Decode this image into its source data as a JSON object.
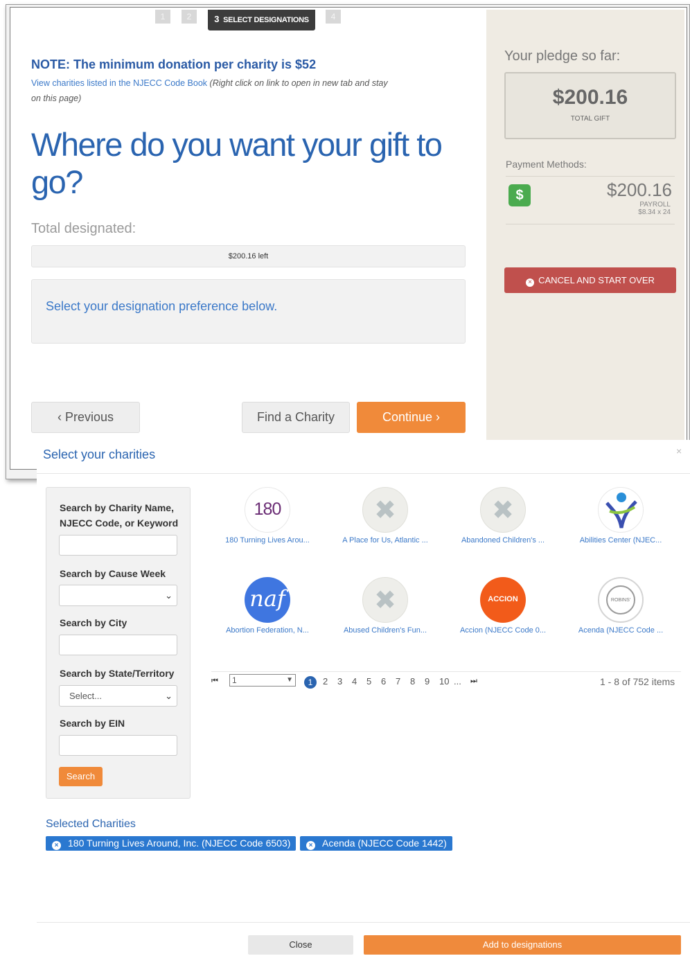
{
  "steps": {
    "s1": "1",
    "s2": "2",
    "active_num": "3",
    "active_label": "SELECT DESIGNATIONS",
    "s4": "4"
  },
  "note": {
    "title": "NOTE: The minimum donation per charity is $52",
    "link_text": "View charities listed in the NJECC Code Book",
    "hint": "(Right click on link to open in new tab and stay on this page)"
  },
  "headline": "Where do you want your gift to go?",
  "total_designated_label": "Total designated:",
  "progress_text": "$200.16 left",
  "preference_text": "Select your designation preference below.",
  "nav": {
    "previous": "Previous",
    "find": "Find a Charity",
    "continue": "Continue"
  },
  "pledge": {
    "title": "Your pledge so far:",
    "amount": "$200.16",
    "sub": "TOTAL GIFT",
    "payment_label": "Payment Methods:",
    "payment_icon": "$",
    "payment_amount": "$200.16",
    "payment_type": "PAYROLL",
    "payment_detail": "$8.34 x 24",
    "cancel": "CANCEL AND START OVER"
  },
  "modal": {
    "title": "Select your charities",
    "close_glyph": "×",
    "search": {
      "name_label": "Search by Charity Name, NJECC Code, or Keyword",
      "cause_label": "Search by Cause Week",
      "city_label": "Search by City",
      "state_label": "Search by State/Territory",
      "state_value": "Select...",
      "ein_label": "Search by EIN",
      "button": "Search"
    },
    "charities": [
      {
        "name": "180 Turning Lives Arou...",
        "logo_text": "180",
        "logo": "180-logo"
      },
      {
        "name": "A Place for Us, Atlantic ...",
        "logo_text": "",
        "logo": "ribbon-icon"
      },
      {
        "name": "Abandoned Children's ...",
        "logo_text": "",
        "logo": "ribbon-icon"
      },
      {
        "name": "Abilities Center (NJEC...",
        "logo_text": "",
        "logo": "abilities-logo"
      },
      {
        "name": "Abortion Federation, N...",
        "logo_text": "naf",
        "logo": "naf-logo"
      },
      {
        "name": "Abused Children's Fun...",
        "logo_text": "",
        "logo": "ribbon-icon"
      },
      {
        "name": "Accion (NJECC Code 0...",
        "logo_text": "ACCION",
        "logo": "accion-logo"
      },
      {
        "name": "Acenda (NJECC Code ...",
        "logo_text": "ROBINS' NEST",
        "logo": "robins-nest-logo"
      }
    ],
    "pager": {
      "select_value": "1",
      "active_page": "1",
      "pages": [
        "2",
        "3",
        "4",
        "5",
        "6",
        "7",
        "8",
        "9",
        "10",
        "..."
      ],
      "info": "1 - 8 of 752 items"
    },
    "selected_title": "Selected Charities",
    "selected": [
      "180 Turning Lives Around, Inc. (NJECC Code 6503)",
      "Acenda (NJECC Code 1442)"
    ],
    "close": "Close",
    "add": "Add to designations"
  },
  "colors": {
    "brand_blue": "#2a64b0",
    "orange": "#f08a3a",
    "danger": "#c0504d",
    "success": "#4bab4f"
  }
}
